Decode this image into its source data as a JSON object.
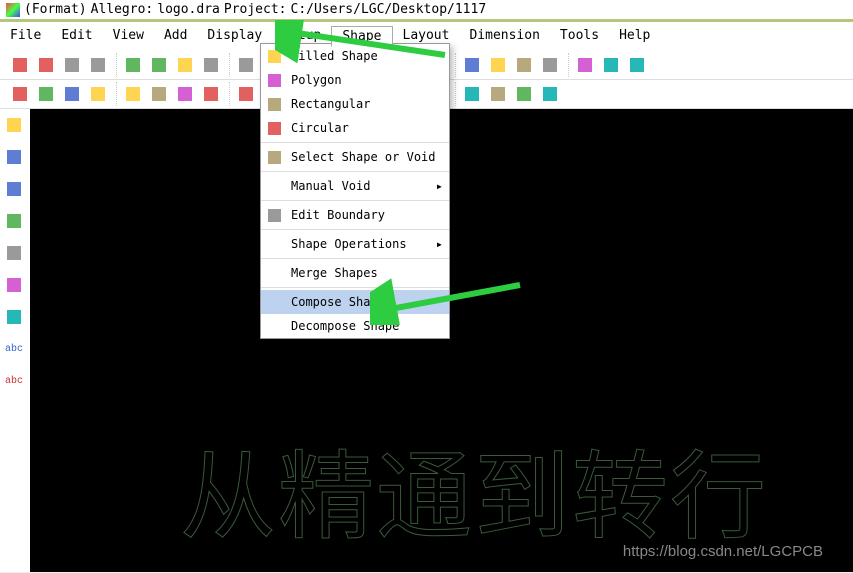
{
  "title": {
    "prefix": "(Format)",
    "app": "Allegro:",
    "file": "logo.dra",
    "proj_label": "Project:",
    "proj_path": "C:/Users/LGC/Desktop/1117"
  },
  "menus": [
    "File",
    "Edit",
    "View",
    "Add",
    "Display",
    "Setup",
    "Shape",
    "Layout",
    "Dimension",
    "Tools",
    "Help"
  ],
  "active_menu_index": 6,
  "shape_menu": {
    "items": [
      {
        "label": "Filled Shape",
        "icon": "square-fill-icon"
      },
      {
        "label": "Polygon",
        "icon": "polygon-icon"
      },
      {
        "label": "Rectangular",
        "icon": "rect-icon"
      },
      {
        "label": "Circular",
        "icon": "circle-icon"
      },
      {
        "sep": true
      },
      {
        "label": "Select Shape or Void",
        "icon": "select-shape-icon"
      },
      {
        "sep": true
      },
      {
        "label": "Manual Void",
        "submenu": true
      },
      {
        "sep": true
      },
      {
        "label": "Edit Boundary",
        "icon": "edit-boundary-icon"
      },
      {
        "sep": true
      },
      {
        "label": "Shape Operations",
        "submenu": true
      },
      {
        "sep": true
      },
      {
        "label": "Merge Shapes"
      },
      {
        "sep": true
      },
      {
        "label": "Compose Shape",
        "highlighted": true
      },
      {
        "label": "Decompose Shape"
      }
    ]
  },
  "toolbar1_icons": [
    "new-icon",
    "open-icon",
    "save-icon",
    "move-icon",
    "copy-icon",
    "swap-icon",
    "prev-icon",
    "next-icon",
    "rotate-icon",
    "align-icon",
    "zoom-in-icon",
    "zoom-out-icon",
    "zoom-fit-icon",
    "redraw-icon",
    "view-3d-icon",
    "flip-icon",
    "grid-1-icon",
    "grid-2-icon",
    "panel-1-icon",
    "panel-2-icon",
    "panel-3-icon",
    "settings-icon",
    "lock-icon"
  ],
  "toolbar2_icons": [
    "layer-g1-icon",
    "layer-g2-icon",
    "layer-g3-icon",
    "layer-g4-icon",
    "layer-r1-icon",
    "layer-r2-icon",
    "tl-top-icon",
    "tl-bot-icon",
    "tl-rgt-icon",
    "thick-icon",
    "layers-icon",
    "eye-icon",
    "chip-icon",
    "reload-icon",
    "ruler-icon",
    "pad-icon",
    "camera-icon",
    "doc-icon",
    "mail-icon",
    "help-icon"
  ],
  "left_tools": [
    "path-icon",
    "poly-icon",
    "step-icon",
    "wave-icon",
    "ground-icon",
    "line-icon",
    "rect-tool-icon",
    "abc-icon",
    "abc-plus-icon"
  ],
  "canvas_text": "从精通到转行",
  "watermark": "https://blog.csdn.net/LGCPCB"
}
